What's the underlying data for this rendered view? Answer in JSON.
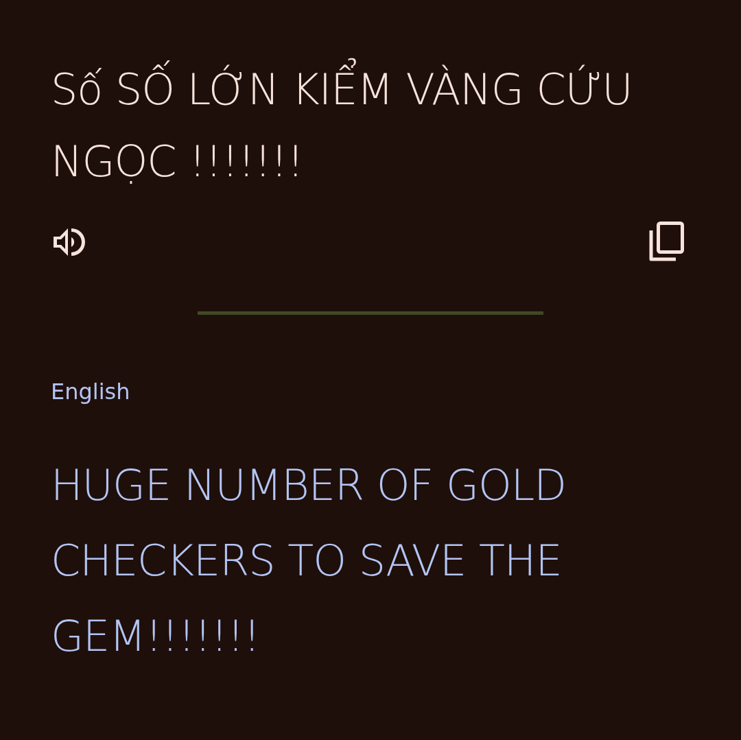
{
  "source": {
    "text": "Số SỐ LỚN KIỂM VÀNG CỨU NGỌC !!!!!!!"
  },
  "target": {
    "language": "English",
    "text": "HUGE NUMBER OF GOLD CHECKERS TO SAVE THE GEM!!!!!!!"
  }
}
